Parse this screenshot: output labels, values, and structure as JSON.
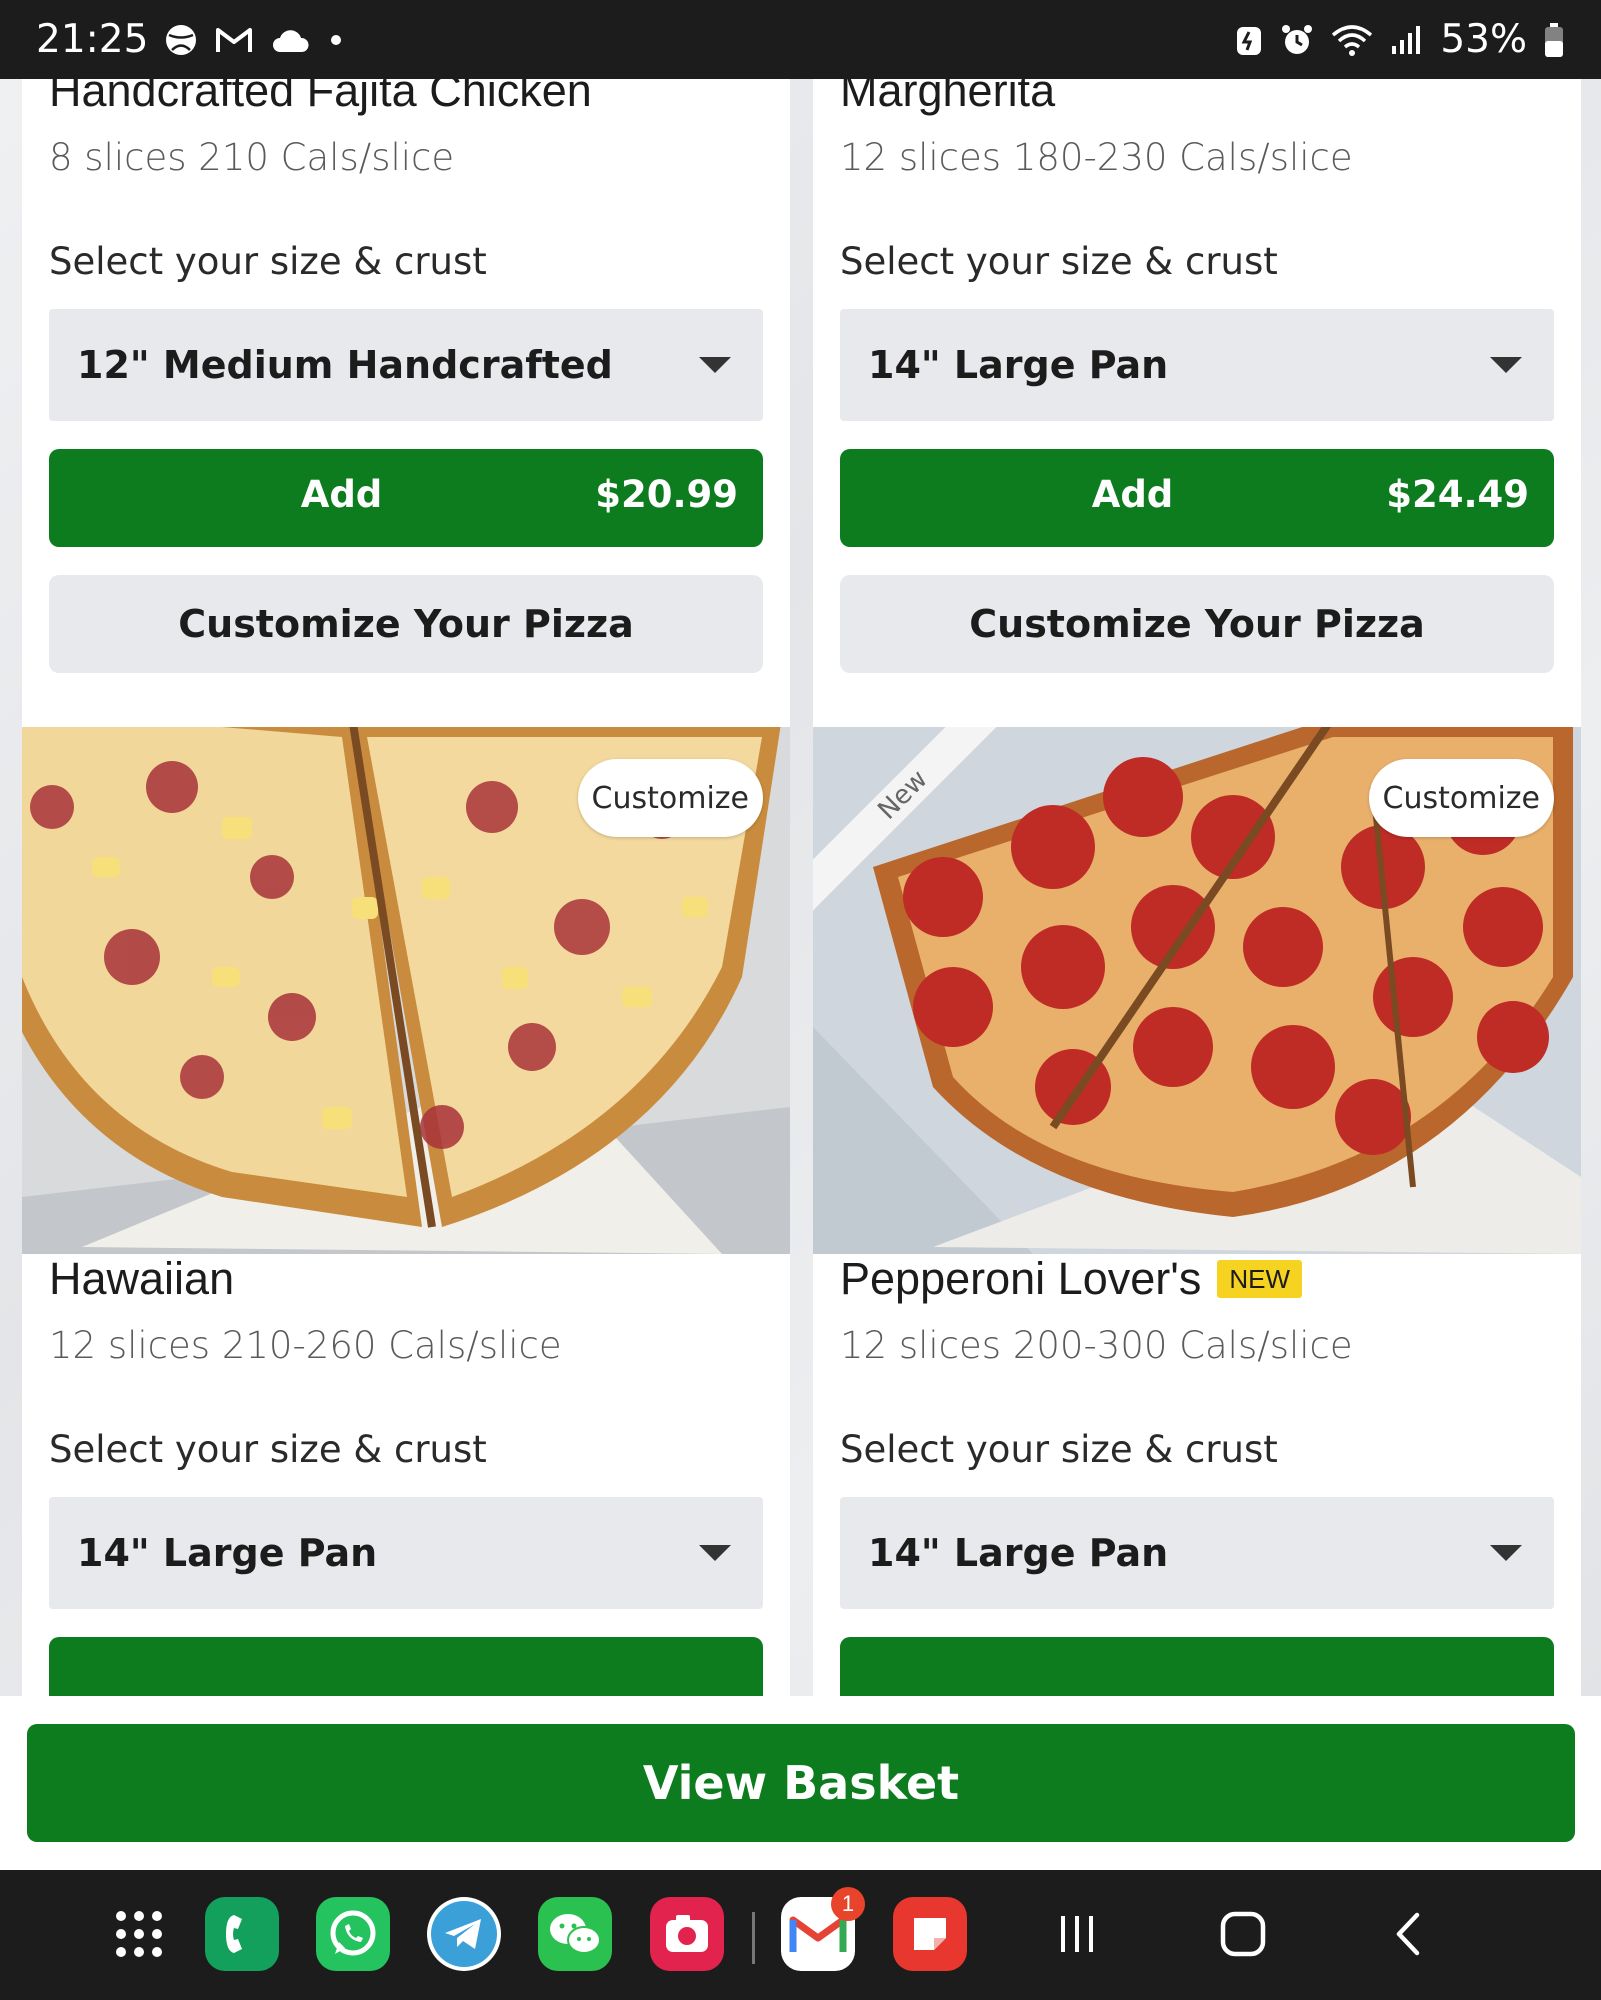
{
  "status_bar": {
    "time": "21:25",
    "battery": "53%"
  },
  "cards": [
    {
      "name": "Handcrafted Fajita Chicken",
      "cals": "8 slices 210 Cals/slice",
      "select_label": "Select your size & crust",
      "selected_size": "12\" Medium Handcrafted",
      "add_label": "Add",
      "price": "$20.99",
      "customize_label": "Customize Your Pizza"
    },
    {
      "name": "Margherita",
      "cals": "12 slices 180-230 Cals/slice",
      "select_label": "Select your size & crust",
      "selected_size": "14\" Large Pan",
      "add_label": "Add",
      "price": "$24.49",
      "customize_label": "Customize Your Pizza"
    },
    {
      "name": "Hawaiian",
      "cals": "12 slices 210-260 Cals/slice",
      "select_label": "Select your size & crust",
      "selected_size": "14\" Large Pan",
      "image_pill": "Customize"
    },
    {
      "name": "Pepperoni Lover's",
      "badge": "NEW",
      "ribbon": "New",
      "cals": "12 slices 200-300 Cals/slice",
      "select_label": "Select your size & crust",
      "selected_size": "14\" Large Pan",
      "image_pill": "Customize"
    }
  ],
  "basket": {
    "label": "View Basket"
  },
  "nav": {
    "apps": [
      "app-drawer-icon",
      "phone-icon",
      "whatsapp-icon",
      "telegram-icon",
      "wechat-icon",
      "camera-icon",
      "gmail-icon",
      "notes-icon"
    ],
    "gmail_badge": "1",
    "accent": "#0c7c1e"
  }
}
